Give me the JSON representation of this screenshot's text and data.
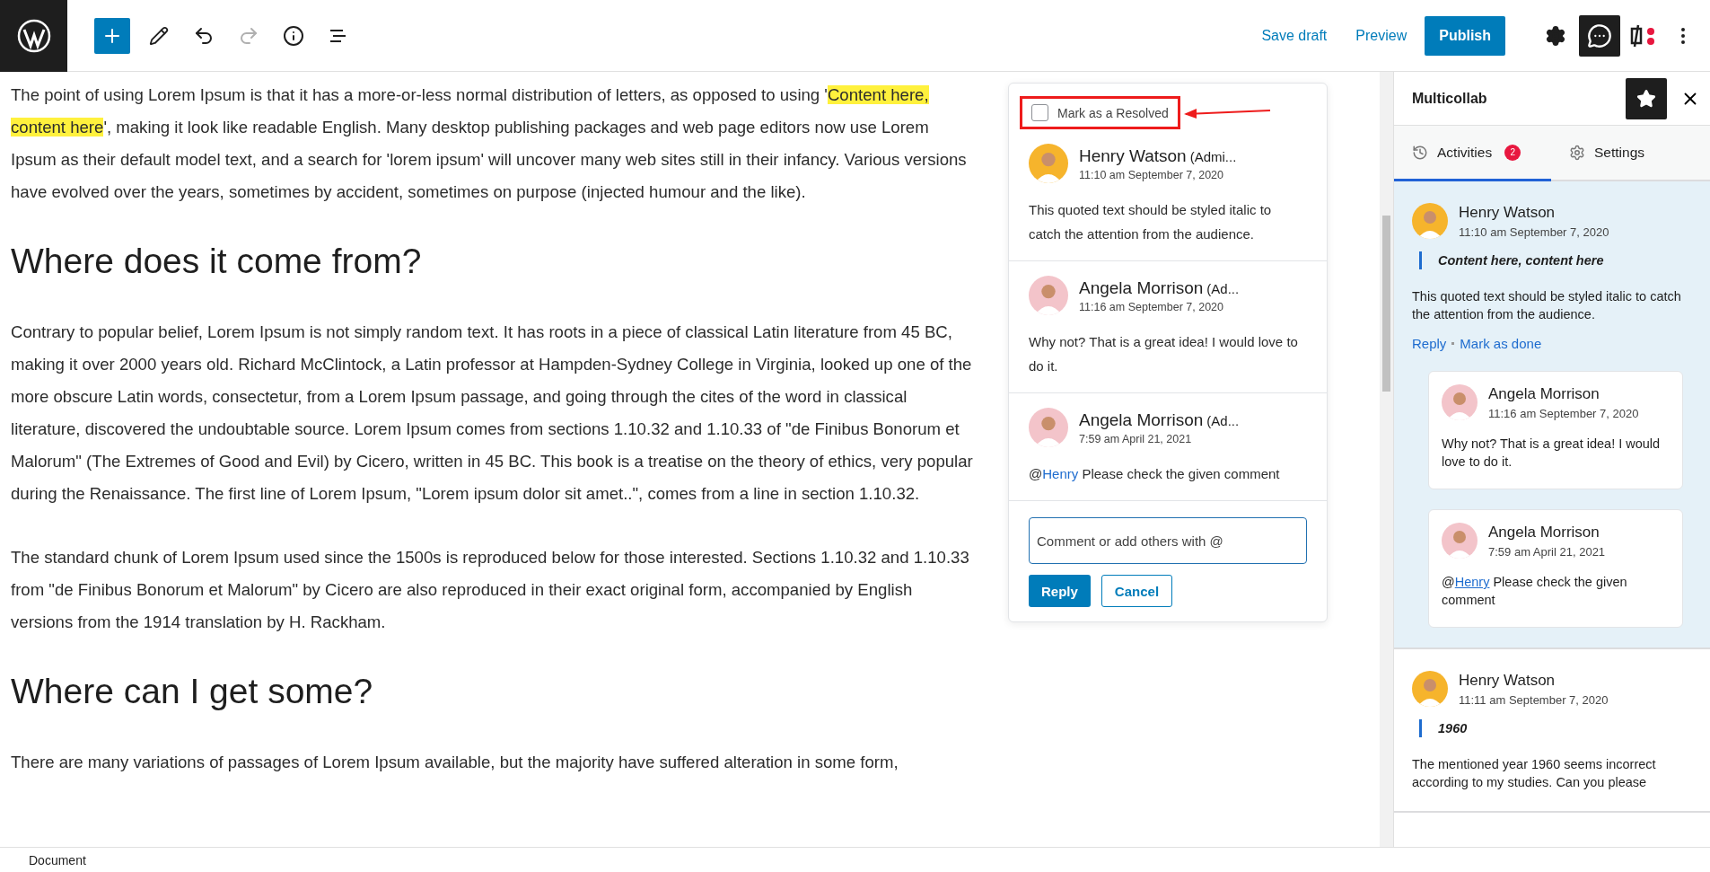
{
  "toolbar": {
    "history": [
      {
        "kind": "undo",
        "disabled": false
      },
      {
        "kind": "redo",
        "disabled": true
      }
    ],
    "save_draft": "Save draft",
    "preview": "Preview",
    "publish": "Publish"
  },
  "editor": {
    "blocks": [
      {
        "kind": "paragraph",
        "parts": [
          {
            "text": "The point of using Lorem Ipsum is that it has a more-or-less normal distribution of letters, as opposed to using '",
            "highlighted": false
          },
          {
            "text": "Content here, content here",
            "highlighted": true
          },
          {
            "text": "', making it look like readable English. Many desktop publishing packages and web page editors now use Lorem Ipsum as their default model text, and a search for 'lorem ipsum' will uncover many web sites still in their infancy. Various versions have evolved over the years, sometimes by accident, sometimes on purpose (injected humour and the like).",
            "highlighted": false
          }
        ]
      },
      {
        "kind": "heading",
        "text": "Where does it come from?"
      },
      {
        "kind": "paragraph",
        "parts": [
          {
            "text": "Contrary to popular belief, Lorem Ipsum is not simply random text. It has roots in a piece of classical Latin literature from 45 BC, making it over 2000 years old. Richard McClintock, a Latin professor at Hampden-Sydney College in Virginia, looked up one of the more obscure Latin words, consectetur, from a Lorem Ipsum passage, and going through the cites of the word in classical literature, discovered the undoubtable source. Lorem Ipsum comes from sections 1.10.32 and 1.10.33 of \"de Finibus Bonorum et Malorum\" (The Extremes of Good and Evil) by Cicero, written in 45 BC. This book is a treatise on the theory of ethics, very popular during the Renaissance. The first line of Lorem Ipsum, \"Lorem ipsum dolor sit amet..\", comes from a line in section 1.10.32.",
            "highlighted": false
          }
        ]
      },
      {
        "kind": "paragraph",
        "parts": [
          {
            "text": "The standard chunk of Lorem Ipsum used since the 1500s is reproduced below for those interested. Sections 1.10.32 and 1.10.33 from \"de Finibus Bonorum et Malorum\" by Cicero are also reproduced in their exact original form, accompanied by English versions from the 1914 translation by H. Rackham.",
            "highlighted": false
          }
        ]
      },
      {
        "kind": "heading",
        "text": "Where can I get some?"
      },
      {
        "kind": "paragraph",
        "parts": [
          {
            "text": "There are many variations of passages of Lorem Ipsum available, but the majority have suffered alteration in some form,",
            "highlighted": false
          }
        ]
      }
    ]
  },
  "comment_popup": {
    "resolve": {
      "label": "Mark as a Resolved",
      "checked": false
    },
    "comments": [
      {
        "author": "Henry Watson",
        "role": "(Admi...",
        "time": "11:10 am September 7, 2020",
        "color": "#f6b42c",
        "body": [
          {
            "kind": "text",
            "text": "This quoted text should be styled italic to catch the attention from the audience."
          }
        ]
      },
      {
        "author": "Angela Morrison",
        "role": "(Ad...",
        "time": "11:16 am September 7, 2020",
        "color": "#f3c4ca",
        "body": [
          {
            "kind": "text",
            "text": "Why not? That is a great idea! I would love to do it."
          }
        ]
      },
      {
        "author": "Angela Morrison",
        "role": "(Ad...",
        "time": "7:59 am April 21, 2021",
        "color": "#f3c4ca",
        "body": [
          {
            "kind": "text",
            "text": "@"
          },
          {
            "kind": "mention",
            "text": "Henry"
          },
          {
            "kind": "text",
            "text": " Please check the given comment"
          }
        ]
      }
    ],
    "input": {
      "placeholder": "Comment or add others with @"
    },
    "reply": "Reply",
    "cancel": "Cancel"
  },
  "sidebar": {
    "title": "Multicollab",
    "tabs": [
      {
        "kind": "activities",
        "label": "Activities",
        "badge": "2",
        "selected": true
      },
      {
        "kind": "settings",
        "label": "Settings",
        "selected": false
      }
    ],
    "threads": [
      {
        "highlighted": true,
        "author": "Henry Watson",
        "time": "11:10 am September 7, 2020",
        "color": "#f6b42c",
        "quote": "Content here, content here",
        "text": "This quoted text should be styled italic to catch the attention from the audience.",
        "actions": [
          "Reply",
          "Mark as done"
        ],
        "replies": [
          {
            "author": "Angela Morrison",
            "time": "11:16 am September 7, 2020",
            "color": "#f3c4ca",
            "body": [
              {
                "kind": "text",
                "text": "Why not? That is a great idea! I would love to do it."
              }
            ]
          },
          {
            "author": "Angela Morrison",
            "time": "7:59 am April 21, 2021",
            "color": "#f3c4ca",
            "body": [
              {
                "kind": "text",
                "text": "@"
              },
              {
                "kind": "mention",
                "text": "Henry"
              },
              {
                "kind": "text",
                "text": " Please check the given comment"
              }
            ]
          }
        ]
      },
      {
        "highlighted": false,
        "author": "Henry Watson",
        "time": "11:11 am September 7, 2020",
        "color": "#f6b42c",
        "quote": "1960",
        "text": "The mentioned year 1960 seems incorrect according to my studies. Can you please"
      }
    ]
  },
  "status_bar": {
    "text": "Document"
  }
}
